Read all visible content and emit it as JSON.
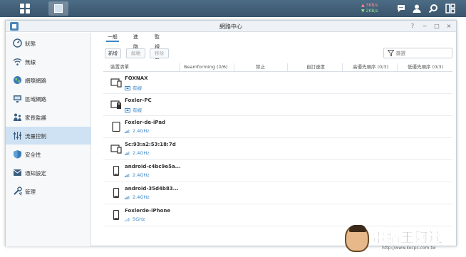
{
  "taskbar": {
    "upload_speed": "3KB/s",
    "download_speed": "2KB/s",
    "icons": [
      "main-menu-icon",
      "network-center-app-icon",
      "chat-icon",
      "user-icon",
      "search-icon",
      "widgets-icon"
    ]
  },
  "window": {
    "title": "網路中心",
    "controls": [
      "?",
      "−",
      "□",
      "×"
    ]
  },
  "sidebar": {
    "items": [
      {
        "label": "狀態",
        "icon": "status-icon"
      },
      {
        "label": "無線",
        "icon": "wifi-icon"
      },
      {
        "label": "網際網路",
        "icon": "internet-icon"
      },
      {
        "label": "區域網路",
        "icon": "lan-icon"
      },
      {
        "label": "家長監護",
        "icon": "parental-icon"
      },
      {
        "label": "流量控制",
        "icon": "traffic-icon",
        "active": true
      },
      {
        "label": "安全性",
        "icon": "shield-icon"
      },
      {
        "label": "通知設定",
        "icon": "notification-icon"
      },
      {
        "label": "管理",
        "icon": "tools-icon"
      }
    ]
  },
  "tabs": [
    {
      "label": "一般",
      "active": true
    },
    {
      "label": "進階"
    },
    {
      "label": "監視器"
    }
  ],
  "toolbar": {
    "add_label": "新增",
    "edit_label": "編輯",
    "remove_label": "移除",
    "filter_placeholder": "篩選"
  },
  "table": {
    "columns": [
      "裝置清單",
      "Beamforming (0/6)",
      "禁止",
      "自訂速度",
      "高優先順序 (0/3)",
      "低優先順序 (0/3)"
    ],
    "rows": [
      {
        "name": "FOXNAX",
        "connection": "有線",
        "device": "desktop"
      },
      {
        "name": "Foxler-PC",
        "connection": "有線",
        "device": "pc"
      },
      {
        "name": "Foxler-de-iPad",
        "connection": "2.4GHz",
        "device": "tablet"
      },
      {
        "name": "5c:93:a2:53:18:7d",
        "connection": "2.4GHz",
        "device": "desktop"
      },
      {
        "name": "android-c4bc9e5a...",
        "connection": "2.4GHz",
        "device": "phone"
      },
      {
        "name": "android-35d4b83...",
        "connection": "2.4GHz",
        "device": "phone"
      },
      {
        "name": "Foxlerde-iPhone",
        "connection": "5GHz",
        "device": "phone"
      }
    ]
  },
  "watermark": {
    "text": "電腦王阿達",
    "url": "http://www.kocpc.com.tw"
  },
  "colors": {
    "accent": "#3d86c6",
    "taskbar": "#3f5a72",
    "active_sidebar": "#cfe2f3"
  }
}
